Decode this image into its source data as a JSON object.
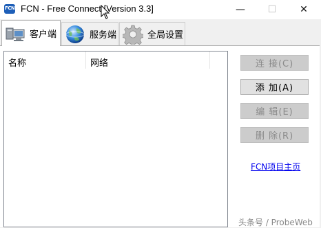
{
  "window": {
    "title": "FCN - Free Connect [Version 3.3]",
    "icon": "fcn-app-icon",
    "icon_text": "FCN",
    "minimize_glyph": "—",
    "maximize_glyph": "☐",
    "close_glyph": "✕"
  },
  "tabs": [
    {
      "label": "客户端",
      "icon": "computer-icon",
      "active": true
    },
    {
      "label": "服务端",
      "icon": "globe-icon",
      "active": false
    },
    {
      "label": "全局设置",
      "icon": "gear-icon",
      "active": false
    }
  ],
  "client": {
    "columns": [
      "名称",
      "网络"
    ],
    "buttons": {
      "connect": "连 接(C)",
      "add": "添 加(A)",
      "edit": "编 辑(E)",
      "delete": "删 除(R)"
    },
    "homepage_link": "FCN项目主页"
  },
  "watermark": "头条号 / ProbeWeb",
  "colors": {
    "link": "#0000ee",
    "disabled_text": "#8a8a8a",
    "app_icon": "#1e5fb8"
  }
}
